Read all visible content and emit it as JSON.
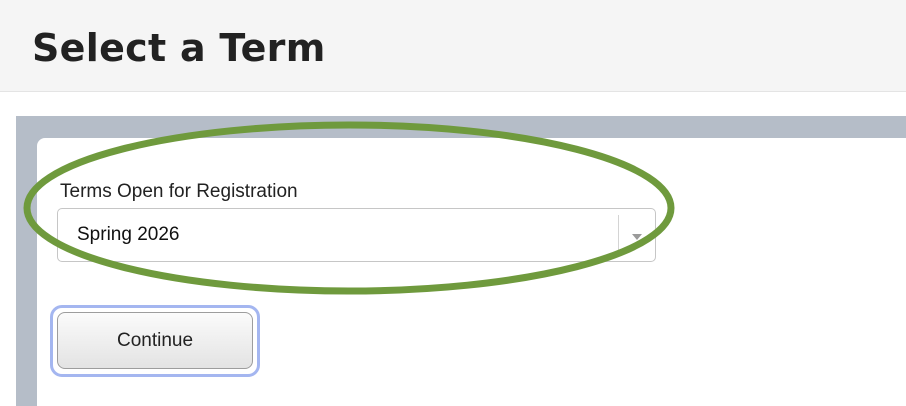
{
  "header": {
    "title": "Select a Term"
  },
  "form": {
    "label": "Terms Open for Registration",
    "selected_term": "Spring 2026",
    "continue_label": "Continue"
  },
  "icons": {
    "dropdown": "chevron-down-icon"
  },
  "colors": {
    "frame": "#b5bdc8",
    "annotation_ellipse": "#6f9a3d",
    "focus_ring": "#a4b6f0"
  }
}
